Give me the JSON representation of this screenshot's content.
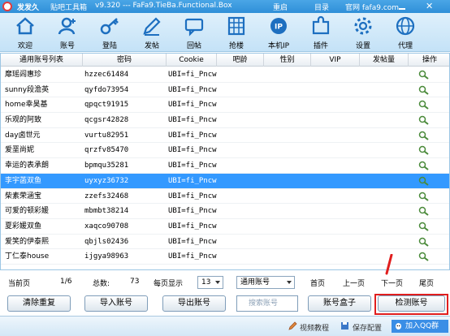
{
  "titlebar": {
    "app_name": "发发久",
    "title": "贴吧工具箱",
    "version": "v9.320 --- FaFa9.TieBa.Functional.Box",
    "reset": "重启",
    "directory": "目录",
    "website": "官网 fafa9.com",
    "close": "✕"
  },
  "toolbar": {
    "items": [
      {
        "label": "欢迎",
        "icon": "home-icon"
      },
      {
        "label": "账号",
        "icon": "account-icon"
      },
      {
        "label": "登陆",
        "icon": "login-icon"
      },
      {
        "label": "发帖",
        "icon": "post-icon"
      },
      {
        "label": "回帖",
        "icon": "reply-icon"
      },
      {
        "label": "抢楼",
        "icon": "grab-floor-icon"
      },
      {
        "label": "本机IP",
        "icon": "ip-icon"
      },
      {
        "label": "插件",
        "icon": "plugin-icon"
      },
      {
        "label": "设置",
        "icon": "gear-icon"
      },
      {
        "label": "代理",
        "icon": "proxy-icon"
      }
    ]
  },
  "table": {
    "columns": [
      "通用账号列表",
      "密码",
      "Cookie",
      "吧龄",
      "性别",
      "VIP",
      "发帖量",
      "操作"
    ],
    "rows": [
      {
        "user": "靡瑶闾惠珍",
        "password": "hzzec61484",
        "cookie": "UBI=fi_Pncw"
      },
      {
        "user": "sunny段澹英",
        "password": "qyfdo73954",
        "cookie": "UBI=fi_Pncw"
      },
      {
        "user": "home幸昊基",
        "password": "qpqct91915",
        "cookie": "UBI=fi_Pncw"
      },
      {
        "user": "乐观的阿致",
        "password": "qcgsr42828",
        "cookie": "UBI=fi_Pncw"
      },
      {
        "user": "day卤世元",
        "password": "vurtu82951",
        "cookie": "UBI=fi_Pncw"
      },
      {
        "user": "爱垩尚妮",
        "password": "qrzfv85470",
        "cookie": "UBI=fi_Pncw"
      },
      {
        "user": "幸运的表承朗",
        "password": "bpmqu35281",
        "cookie": "UBI=fi_Pncw"
      },
      {
        "user": "李宇菡双鱼",
        "password": "uyxyz36732",
        "cookie": "UBI=fi_Pncw"
      },
      {
        "user": "柴素荣涵宝",
        "password": "zzefs32468",
        "cookie": "UBI=fi_Pncw"
      },
      {
        "user": "可爱的顿彩媛",
        "password": "mbmbt38214",
        "cookie": "UBI=fi_Pncw"
      },
      {
        "user": "夏彩媛双鱼",
        "password": "xaqco90708",
        "cookie": "UBI=fi_Pncw"
      },
      {
        "user": "爱笑的伊泰熙",
        "password": "qbjls02436",
        "cookie": "UBI=fi_Pncw"
      },
      {
        "user": "丁仁泰house",
        "password": "ijgya98963",
        "cookie": "UBI=fi_Pncw"
      }
    ],
    "selected_row": 7
  },
  "pager": {
    "current_label": "当前页",
    "current_value": "1/6",
    "total_label": "总数:",
    "total_value": "73",
    "per_page_label": "每页显示",
    "per_page_value": "13",
    "account_type": "通用账号",
    "first": "首页",
    "prev": "上一页",
    "next": "下一页",
    "last": "尾页"
  },
  "buttons": {
    "clear_dup": "清除重复",
    "import": "导入账号",
    "export": "导出账号",
    "search_placeholder": "搜索账号",
    "account_box": "账号盒子",
    "check": "检测账号"
  },
  "statusbar": {
    "video": "视频教程",
    "save": "保存配置",
    "qq": "加入QQ群"
  },
  "colors": {
    "titlebar": "#2f8fd8",
    "selected_row": "#3399ff",
    "highlight": "#e01e1e"
  }
}
